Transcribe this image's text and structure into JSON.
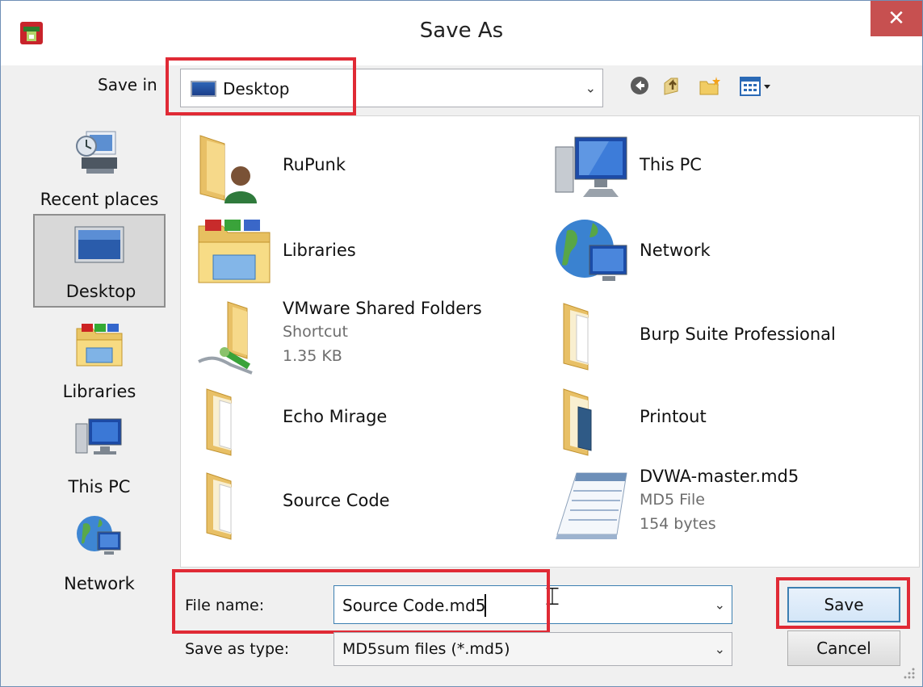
{
  "window": {
    "title": "Save As",
    "close_glyph": "✕",
    "app_icon": "app-logo-icon"
  },
  "save_in": {
    "label": "Save in",
    "value": "Desktop",
    "icon": "desktop-icon"
  },
  "toolbar": {
    "buttons": [
      "back-icon",
      "up-folder-icon",
      "new-folder-icon",
      "view-menu-icon"
    ]
  },
  "places": [
    {
      "label": "Recent places",
      "icon": "recent-places-icon"
    },
    {
      "label": "Desktop",
      "icon": "desktop-icon",
      "selected": true
    },
    {
      "label": "Libraries",
      "icon": "libraries-icon"
    },
    {
      "label": "This PC",
      "icon": "this-pc-icon"
    },
    {
      "label": "Network",
      "icon": "network-icon"
    }
  ],
  "files": [
    {
      "name": "RuPunk",
      "icon": "user-folder-icon"
    },
    {
      "name": "This PC",
      "icon": "this-pc-icon"
    },
    {
      "name": "Libraries",
      "icon": "libraries-icon"
    },
    {
      "name": "Network",
      "icon": "network-icon"
    },
    {
      "name": "VMware Shared Folders",
      "type": "Shortcut",
      "size": "1.35 KB",
      "icon": "shortcut-folder-icon"
    },
    {
      "name": "Burp Suite Professional",
      "icon": "folder-icon"
    },
    {
      "name": "Echo Mirage",
      "icon": "folder-icon"
    },
    {
      "name": "Printout",
      "icon": "folder-icon"
    },
    {
      "name": "Source Code",
      "icon": "folder-icon"
    },
    {
      "name": "DVWA-master.md5",
      "type": "MD5 File",
      "size": "154 bytes",
      "icon": "text-file-icon"
    }
  ],
  "file_name": {
    "label": "File name:",
    "value": "Source Code.md5"
  },
  "save_as_type": {
    "label": "Save as type:",
    "value": "MD5sum files (*.md5)"
  },
  "buttons": {
    "save": "Save",
    "cancel": "Cancel"
  },
  "dropdown_glyph": "⌄",
  "colors": {
    "highlight_box": "#e02a35",
    "close_button": "#c75050",
    "focus_border": "#3c7fb1"
  }
}
